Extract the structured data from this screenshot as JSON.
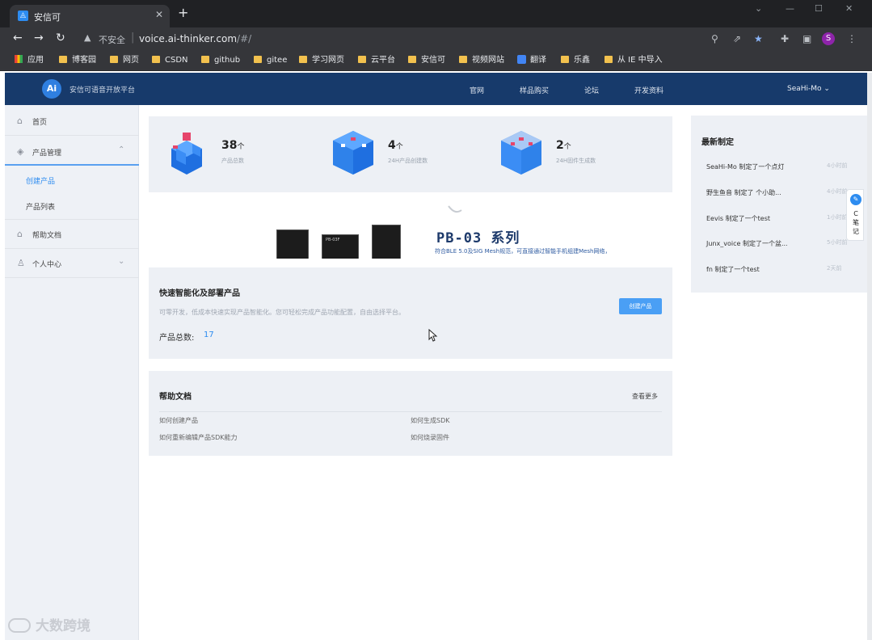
{
  "browser": {
    "tab_title": "安信可",
    "tab_close": "✕",
    "new_tab": "+",
    "insecure_label": "不安全",
    "url_host": "voice.ai-thinker.com",
    "url_path": "/#/",
    "profile_initial": "S",
    "bookmarks": [
      {
        "label": "应用",
        "icon": "apps-icon"
      },
      {
        "label": "博客园",
        "icon": "folder-icon"
      },
      {
        "label": "网页",
        "icon": "folder-icon"
      },
      {
        "label": "CSDN",
        "icon": "folder-icon"
      },
      {
        "label": "github",
        "icon": "folder-icon"
      },
      {
        "label": "gitee",
        "icon": "folder-icon"
      },
      {
        "label": "学习网页",
        "icon": "folder-icon"
      },
      {
        "label": "云平台",
        "icon": "folder-icon"
      },
      {
        "label": "安信可",
        "icon": "folder-icon"
      },
      {
        "label": "视频网站",
        "icon": "folder-icon"
      },
      {
        "label": "翻译",
        "icon": "translate-icon"
      },
      {
        "label": "乐鑫",
        "icon": "folder-icon"
      },
      {
        "label": "从 IE 中导入",
        "icon": "folder-icon"
      }
    ]
  },
  "header": {
    "logo_text": "Ai",
    "brand": "安信可语音开放平台",
    "nav": [
      "官网",
      "样品购买",
      "论坛",
      "开发资料"
    ],
    "user": "SeaHi-Mo ⌄"
  },
  "sidebar": {
    "home": "首页",
    "product_mgmt": "产品管理",
    "create_product": "创建产品",
    "product_list": "产品列表",
    "help_docs": "帮助文档",
    "personal_center": "个人中心",
    "chevron_up": "⌃",
    "chevron_down": "⌄"
  },
  "stats": [
    {
      "num": "38",
      "unit": "个",
      "label": "产品总数"
    },
    {
      "num": "4",
      "unit": "个",
      "label": "24H产品创建数"
    },
    {
      "num": "2",
      "unit": "个",
      "label": "24H固件生成数"
    }
  ],
  "banner": {
    "title": "PB-03 系列",
    "subtitle": "符合BLE 5.0及SIG Mesh规范，可直接通过智能手机组建Mesh网络，",
    "chips": [
      "",
      "PB-03F",
      ""
    ]
  },
  "quick": {
    "title": "快速智能化及部署产品",
    "desc": "可零开发，低成本快速实现产品智能化。您可轻松完成产品功能配置，自由选择平台。",
    "count_label": "产品总数:",
    "count": "17",
    "button": "创建产品"
  },
  "help": {
    "title": "帮助文档",
    "more": "查看更多",
    "links": [
      "如何创建产品",
      "如何生成SDK",
      "如何重新编辑产品SDK能力",
      "如何烧录固件"
    ]
  },
  "recent": {
    "title": "最新制定",
    "items": [
      {
        "text": "SeaHi-Mo 制定了一个点灯",
        "time": "4小时前"
      },
      {
        "text": "野生鱼音 制定了 个小助...",
        "time": "4小时前"
      },
      {
        "text": "Eevis 制定了一个test",
        "time": "1小时前"
      },
      {
        "text": "Junx_voice 制定了一个盆...",
        "time": "5小时前"
      },
      {
        "text": "fn 制定了一个test",
        "time": "2天前"
      }
    ]
  },
  "float_note": {
    "label": "C 笔记"
  },
  "watermark": "大数跨境",
  "colors": {
    "header_bg": "#173a6b",
    "accent": "#2d8cf0",
    "panel_bg": "#edf0f5"
  }
}
